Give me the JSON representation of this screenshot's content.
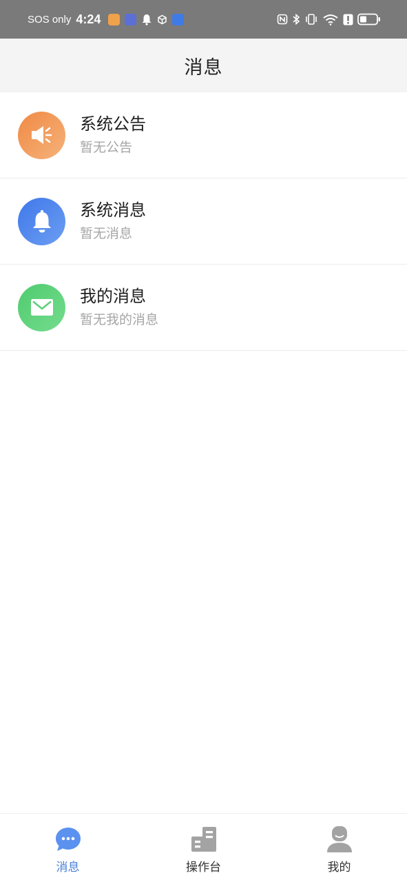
{
  "status_bar": {
    "sos_text": "SOS only",
    "time": "4:24",
    "icons": [
      "app-badge-orange",
      "app-badge-blue",
      "bell-icon",
      "cube-icon",
      "app-badge-bird",
      "nfc-icon",
      "bluetooth-icon",
      "vibrate-icon",
      "wifi-icon",
      "alert-icon",
      "battery-icon"
    ]
  },
  "header": {
    "title": "消息"
  },
  "messages": [
    {
      "title": "系统公告",
      "subtitle": "暂无公告",
      "icon": "megaphone-icon",
      "color": "#f29a5a"
    },
    {
      "title": "系统消息",
      "subtitle": "暂无消息",
      "icon": "bell-icon",
      "color": "#4f86ec"
    },
    {
      "title": "我的消息",
      "subtitle": "暂无我的消息",
      "icon": "envelope-icon",
      "color": "#5cd17a"
    }
  ],
  "tabs": [
    {
      "label": "消息",
      "icon": "chat-bubble-icon",
      "active": true
    },
    {
      "label": "操作台",
      "icon": "building-icon",
      "active": false
    },
    {
      "label": "我的",
      "icon": "person-icon",
      "active": false
    }
  ],
  "colors": {
    "active_tab": "#4a7fd8",
    "inactive_tab_icon": "#a3a3a3"
  }
}
